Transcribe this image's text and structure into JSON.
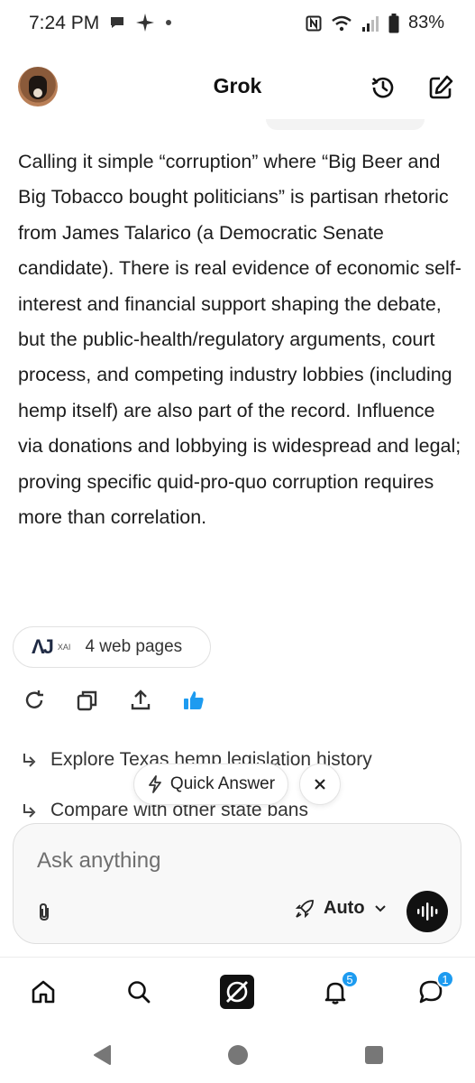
{
  "status_bar": {
    "time": "7:24 PM",
    "left_icons": [
      "chat-bubble-icon",
      "sparkle-icon",
      "dot-icon"
    ],
    "right_icons": [
      "nfc-icon",
      "wifi-icon",
      "signal-icon",
      "battery-icon"
    ],
    "battery": "83%"
  },
  "header": {
    "title": "Grok",
    "actions": [
      "history-icon",
      "new-chat-icon"
    ]
  },
  "message": {
    "text": "Calling it simple “corruption” where “Big Beer and Big Tobacco bought politicians” is partisan rhetoric from James Talarico (a Democratic Senate candidate). There is real evidence of economic self-interest and financial support shaping the debate, but the public-health/regulatory arguments, court process, and competing industry lobbies (including hemp itself) are also part of the record. Influence via donations and lobbying is widespread and legal; proving specific quid-pro-quo corruption requires more than correlation."
  },
  "sources": {
    "logo_a": "ΛJ",
    "logo_b": "XAI",
    "label": "4 web pages"
  },
  "actions": [
    "regenerate-icon",
    "copy-icon",
    "share-icon",
    "thumbs-up-icon"
  ],
  "suggestions": [
    "Explore Texas hemp legislation history",
    "Compare with other state bans"
  ],
  "quick_answer": {
    "label": "Quick Answer"
  },
  "composer": {
    "placeholder": "Ask anything",
    "mode": "Auto"
  },
  "bottom_nav": {
    "items": [
      "home-icon",
      "search-icon",
      "grok-icon",
      "notifications-icon",
      "messages-icon"
    ],
    "notifications_badge": "5",
    "messages_badge": "1"
  },
  "colors": {
    "accent": "#1d9bf0",
    "text": "#1c1c1c"
  }
}
